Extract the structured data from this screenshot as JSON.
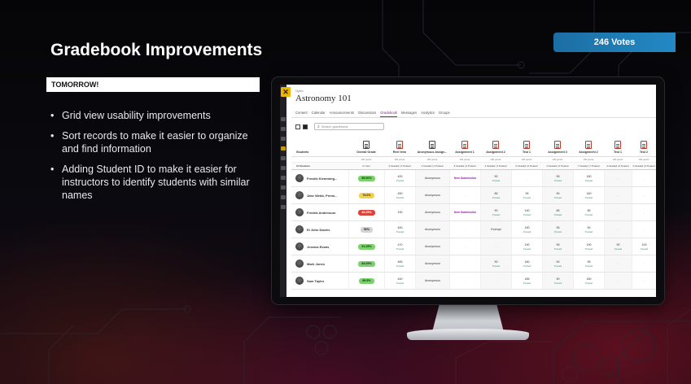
{
  "slide": {
    "title": "Gradebook Improvements",
    "votes": "246 Votes",
    "status": "TOMORROW!",
    "bullets": [
      "Grid view usability improvements",
      "Sort records to make it easier to organize and find information",
      "Adding Student ID to make it easier for instructors to identify students with similar names"
    ]
  },
  "colors": {
    "vote_badge": "#2389c4",
    "accent_purple": "#8c1ea0",
    "close_yellow": "#f0b400"
  },
  "app": {
    "breadcrumb": "Open",
    "course_title": "Astronomy 101",
    "nav": [
      "Content",
      "Calendar",
      "Announcements",
      "Discussions",
      "Gradebook",
      "Messages",
      "Analytics",
      "Groups"
    ],
    "active_nav": "Gradebook",
    "search_placeholder": "Search gradebook",
    "close_icon": "close-icon",
    "grid": {
      "header_first": "Students",
      "columns": [
        "Overall Grade",
        "Reel term",
        "Anonymous Assign...",
        "Assignment 1",
        "Assignment 2",
        "Test 1",
        "Assignment 3",
        "Assignment 2",
        "Test 1",
        "Test 2"
      ],
      "points": [
        "100 points",
        "100 points",
        "100 points",
        "100 points",
        "100 points",
        "100 points",
        "100 points",
        "100 points",
        "100 points",
        "100 points"
      ],
      "count_label": "10 Students",
      "counts": [
        "17 item",
        "0 Graded | 4 Posted",
        "4 Graded | 4 Posted",
        "6 Graded | 6 Posted",
        "4 Graded | 4 Posted",
        "0 Graded | 0 Posted",
        "0 Graded | 0 Posted",
        "7 Graded | 7 Posted",
        "0 Graded | 0 Posted",
        "0 Graded | 0 Posted"
      ],
      "posted_label": "Posted",
      "rows": [
        {
          "name": "Fredrik Klemming...",
          "grade": "85.00%",
          "grade_color": "green",
          "cells": [
            [
              "400",
              "Posted"
            ],
            [
              "Anonymous",
              ""
            ],
            [
              "New Submission",
              ""
            ],
            [
              "90",
              "Posted"
            ],
            [
              "-",
              ""
            ],
            [
              "95",
              "Posted"
            ],
            [
              "180",
              "Posted"
            ],
            [
              "-",
              ""
            ],
            [
              "-",
              ""
            ]
          ]
        },
        {
          "name": "Jake Webb, Premi...",
          "grade": "75.0%",
          "grade_color": "yellow",
          "cells": [
            [
              "450",
              "Posted"
            ],
            [
              "Anonymous",
              ""
            ],
            [
              "-",
              ""
            ],
            [
              "85",
              "Posted"
            ],
            [
              "95",
              "Posted"
            ],
            [
              "90",
              "Posted"
            ],
            [
              "160",
              "Posted"
            ],
            [
              "-",
              ""
            ],
            [
              "-",
              ""
            ]
          ]
        },
        {
          "name": "Fredrik Andersson",
          "grade": "48.25%",
          "grade_color": "red",
          "cells": [
            [
              "190",
              ""
            ],
            [
              "Anonymous",
              ""
            ],
            [
              "New Submission",
              ""
            ],
            [
              "90",
              "Posted"
            ],
            [
              "190",
              "Posted"
            ],
            [
              "85",
              "Posted"
            ],
            [
              "85",
              "Posted"
            ],
            [
              "-",
              ""
            ],
            [
              "-",
              ""
            ]
          ]
        },
        {
          "name": "El John Davies",
          "grade": "56%",
          "grade_color": "grey",
          "cells": [
            [
              "490",
              "Posted"
            ],
            [
              "Anonymous",
              ""
            ],
            [
              "-",
              ""
            ],
            [
              "Exempt",
              ""
            ],
            [
              "190",
              "Posted"
            ],
            [
              "95",
              "Posted"
            ],
            [
              "90",
              "Posted"
            ],
            [
              "-",
              ""
            ],
            [
              "-",
              ""
            ]
          ]
        },
        {
          "name": "Jessica Evans",
          "grade": "91.25%",
          "grade_color": "green",
          "cells": [
            [
              "470",
              "Posted"
            ],
            [
              "Anonymous",
              ""
            ],
            [
              "-",
              ""
            ],
            [
              "-",
              ""
            ],
            [
              "190",
              "Posted"
            ],
            [
              "95",
              "Posted"
            ],
            [
              "190",
              "Posted"
            ],
            [
              "90",
              "Posted"
            ],
            [
              "100",
              "Posted"
            ]
          ]
        },
        {
          "name": "Mark Jones",
          "grade": "84.09%",
          "grade_color": "green",
          "cells": [
            [
              "465",
              "Posted"
            ],
            [
              "Anonymous",
              ""
            ],
            [
              "-",
              ""
            ],
            [
              "90",
              "Posted"
            ],
            [
              "180",
              "Posted"
            ],
            [
              "90",
              "Posted"
            ],
            [
              "95",
              "Posted"
            ],
            [
              "-",
              ""
            ],
            [
              "-",
              ""
            ]
          ]
        },
        {
          "name": "Sam Taylor",
          "grade": "89.5%",
          "grade_color": "green",
          "cells": [
            [
              "440",
              "Posted"
            ],
            [
              "Anonymous",
              ""
            ],
            [
              "-",
              ""
            ],
            [
              "-",
              ""
            ],
            [
              "185",
              "Posted"
            ],
            [
              "90",
              "Posted"
            ],
            [
              "180",
              "Posted"
            ],
            [
              "-",
              ""
            ],
            [
              "-",
              ""
            ]
          ]
        }
      ]
    }
  }
}
